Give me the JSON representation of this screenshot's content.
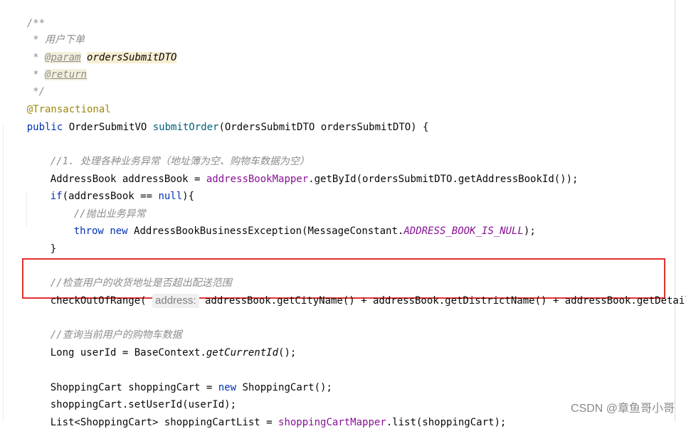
{
  "code": {
    "doc_open": "/**",
    "doc_desc": " * 用户下单",
    "doc_param_prefix": " * ",
    "doc_param_tag": "@param",
    "doc_param_name": "ordersSubmitDTO",
    "doc_return_prefix": " * ",
    "doc_return_tag": "@return",
    "doc_close": " */",
    "annotation": "@Transactional",
    "sig_public": "public",
    "sig_return_type": " OrderSubmitVO ",
    "sig_method": "submitOrder",
    "sig_params": "(OrdersSubmitDTO ordersSubmitDTO) {",
    "cmt_step1": "//1. 处理各种业务异常（地址簿为空、购物车数据为空）",
    "ab_decl": "AddressBook addressBook = ",
    "ab_mapper": "addressBookMapper",
    "ab_call": ".getById(ordersSubmitDTO.getAddressBookId());",
    "if_kw": "if",
    "if_cond": "(addressBook == ",
    "if_null": "null",
    "if_end": "){",
    "cmt_throw": "//抛出业务异常",
    "throw_kw": "throw",
    "new_kw": "new",
    "throw_rest": " AddressBookBusinessException(MessageConstant.",
    "throw_const": "ADDRESS_BOOK_IS_NULL",
    "throw_end": ");",
    "close_brace": "}",
    "cmt_check": "//检查用户的收货地址是否超出配送范围",
    "check_call": "checkOutOfRange(",
    "check_hint": "address:",
    "check_args": " addressBook.getCityName() + addressBook.getDistrictName() + addressBook.getDetail());",
    "cmt_user": "//查询当前用户的购物车数据",
    "user_decl": "Long userId = BaseContext.",
    "user_call": "getCurrentId",
    "user_end": "();",
    "sc_decl": "ShoppingCart shoppingCart = ",
    "sc_new": "new",
    "sc_end": " ShoppingCart();",
    "sc_set": "shoppingCart.setUserId(userId);",
    "list_decl": "List<ShoppingCart> shoppingCartList = ",
    "list_mapper": "shoppingCartMapper",
    "list_end": ".list(shoppingCart);"
  },
  "watermark": "CSDN @章鱼哥小哥",
  "colors": {
    "keyword": "#0033b3",
    "comment": "#8c8c8c",
    "field": "#871094",
    "annotation": "#9e880d",
    "highlight_border": "#e0312f"
  }
}
